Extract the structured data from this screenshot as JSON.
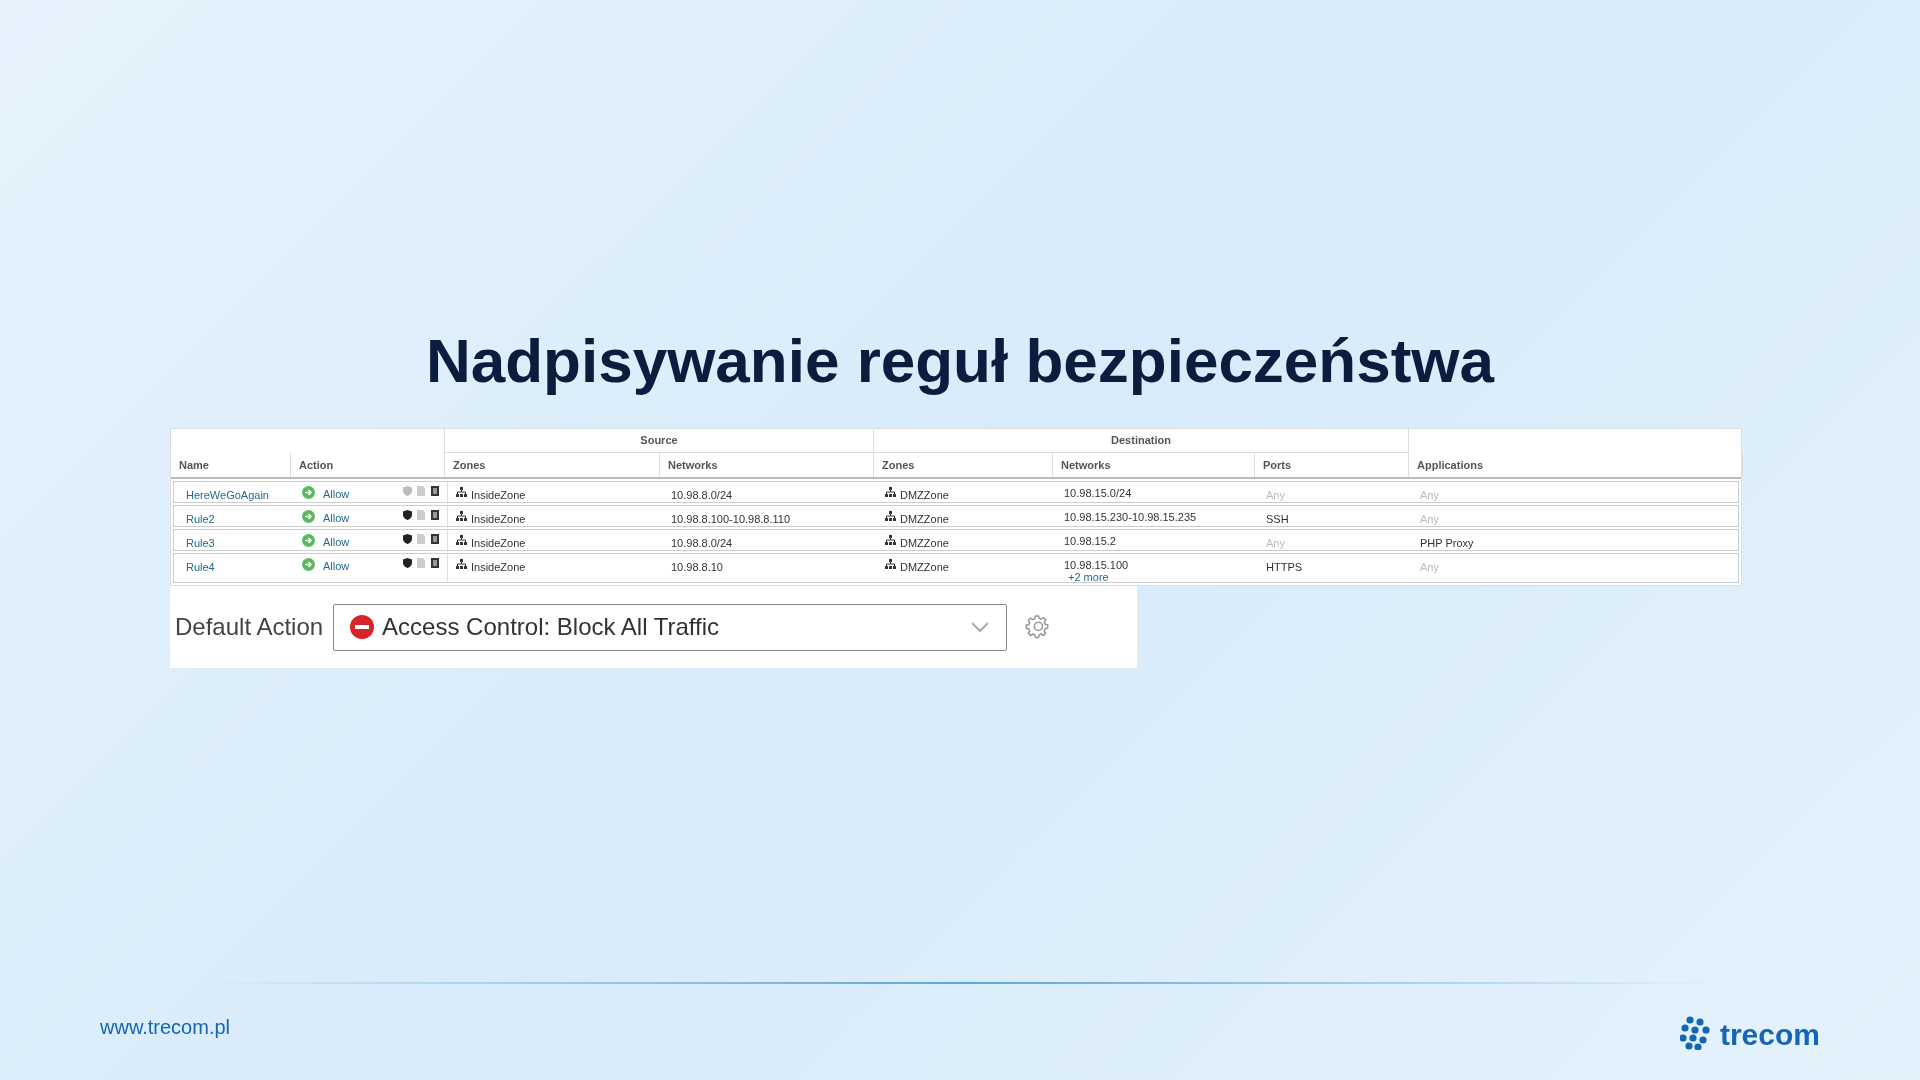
{
  "title": "Nadpisywanie reguł bezpieczeństwa",
  "table": {
    "groups": [
      {
        "label": "Source"
      },
      {
        "label": "Destination"
      }
    ],
    "columns": [
      "Name",
      "Action",
      "Zones",
      "Networks",
      "Zones",
      "Networks",
      "Ports",
      "Applications"
    ],
    "rows": [
      {
        "name": "HereWeGoAgain",
        "action": "Allow",
        "intrusion_policy": false,
        "source_zone": "InsideZone",
        "source_network": "10.98.8.0/24",
        "destination_zone": "DMZZone",
        "destination_network": "10.98.15.0/24",
        "port": {
          "text": "Any",
          "muted": true
        },
        "application": {
          "text": "Any",
          "muted": true
        }
      },
      {
        "name": "Rule2",
        "action": "Allow",
        "intrusion_policy": true,
        "source_zone": "InsideZone",
        "source_network": "10.98.8.100-10.98.8.110",
        "destination_zone": "DMZZone",
        "destination_network": "10.98.15.230-10.98.15.235",
        "port": {
          "text": "SSH",
          "muted": false
        },
        "application": {
          "text": "Any",
          "muted": true
        }
      },
      {
        "name": "Rule3",
        "action": "Allow",
        "intrusion_policy": true,
        "source_zone": "InsideZone",
        "source_network": "10.98.8.0/24",
        "destination_zone": "DMZZone",
        "destination_network": "10.98.15.2",
        "port": {
          "text": "Any",
          "muted": true
        },
        "application": {
          "text": "PHP Proxy",
          "muted": false
        }
      },
      {
        "name": "Rule4",
        "action": "Allow",
        "intrusion_policy": true,
        "source_zone": "InsideZone",
        "source_network": "10.98.8.10",
        "destination_zone": "DMZZone",
        "destination_network": "10.98.15.100",
        "more": "+2 more",
        "port": {
          "text": "HTTPS",
          "muted": false
        },
        "application": {
          "text": "Any",
          "muted": true
        }
      }
    ]
  },
  "default_action": {
    "label": "Default Action",
    "value": "Access Control: Block All Traffic"
  },
  "footer": {
    "url": "www.trecom.pl",
    "logo_text": "trecom"
  }
}
